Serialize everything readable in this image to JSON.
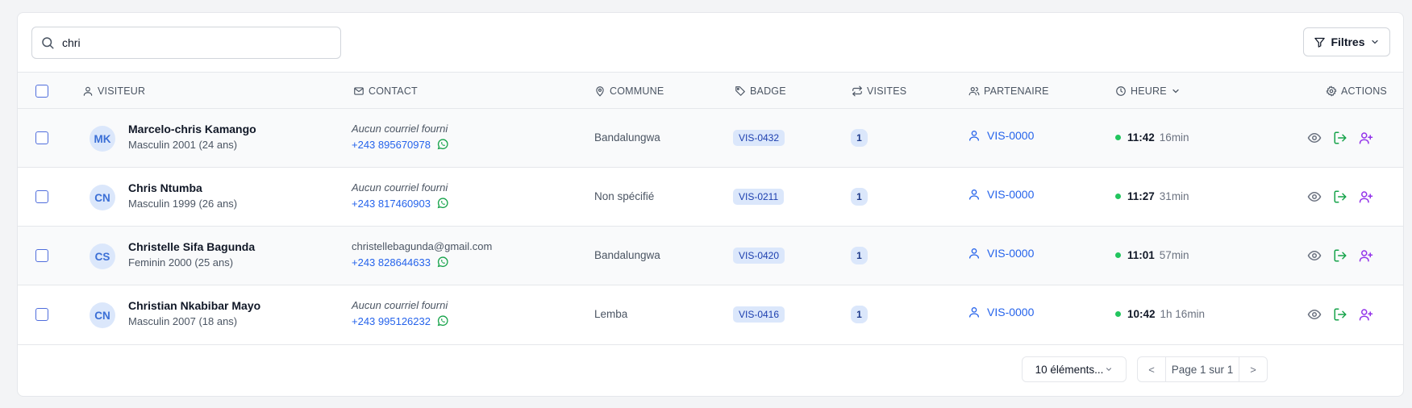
{
  "search": {
    "value": "chri"
  },
  "filter_button": {
    "label": "Filtres"
  },
  "columns": {
    "visitor": "VISITEUR",
    "contact": "CONTACT",
    "commune": "COMMUNE",
    "badge": "BADGE",
    "visits": "VISITES",
    "partner": "PARTENAIRE",
    "time": "HEURE",
    "actions": "ACTIONS"
  },
  "rows": [
    {
      "initials": "MK",
      "name": "Marcelo-chris Kamango",
      "info": "Masculin 2001 (24 ans)",
      "email": "Aucun courriel fourni",
      "email_missing": true,
      "phone": "+243 895670978",
      "commune": "Bandalungwa",
      "badge": "VIS-0432",
      "visits": "1",
      "partner": "VIS-0000",
      "time": "11:42",
      "duration": "16min"
    },
    {
      "initials": "CN",
      "name": "Chris Ntumba",
      "info": "Masculin 1999 (26 ans)",
      "email": "Aucun courriel fourni",
      "email_missing": true,
      "phone": "+243 817460903",
      "commune": "Non spécifié",
      "badge": "VIS-0211",
      "visits": "1",
      "partner": "VIS-0000",
      "time": "11:27",
      "duration": "31min"
    },
    {
      "initials": "CS",
      "name": "Christelle Sifa Bagunda",
      "info": "Feminin 2000 (25 ans)",
      "email": "christellebagunda@gmail.com",
      "email_missing": false,
      "phone": "+243 828644633",
      "commune": "Bandalungwa",
      "badge": "VIS-0420",
      "visits": "1",
      "partner": "VIS-0000",
      "time": "11:01",
      "duration": "57min"
    },
    {
      "initials": "CN",
      "name": "Christian Nkabibar Mayo",
      "info": "Masculin 2007 (18 ans)",
      "email": "Aucun courriel fourni",
      "email_missing": true,
      "phone": "+243 995126232",
      "commune": "Lemba",
      "badge": "VIS-0416",
      "visits": "1",
      "partner": "VIS-0000",
      "time": "10:42",
      "duration": "1h 16min"
    }
  ],
  "footer": {
    "page_size": "10 éléments...",
    "page_label": "Page 1 sur 1",
    "prev": "<",
    "next": ">"
  },
  "colors": {
    "accent_blue": "#2563eb",
    "status_green": "#22c55e",
    "exit_green": "#16a34a",
    "partner_purple": "#9333ea"
  }
}
